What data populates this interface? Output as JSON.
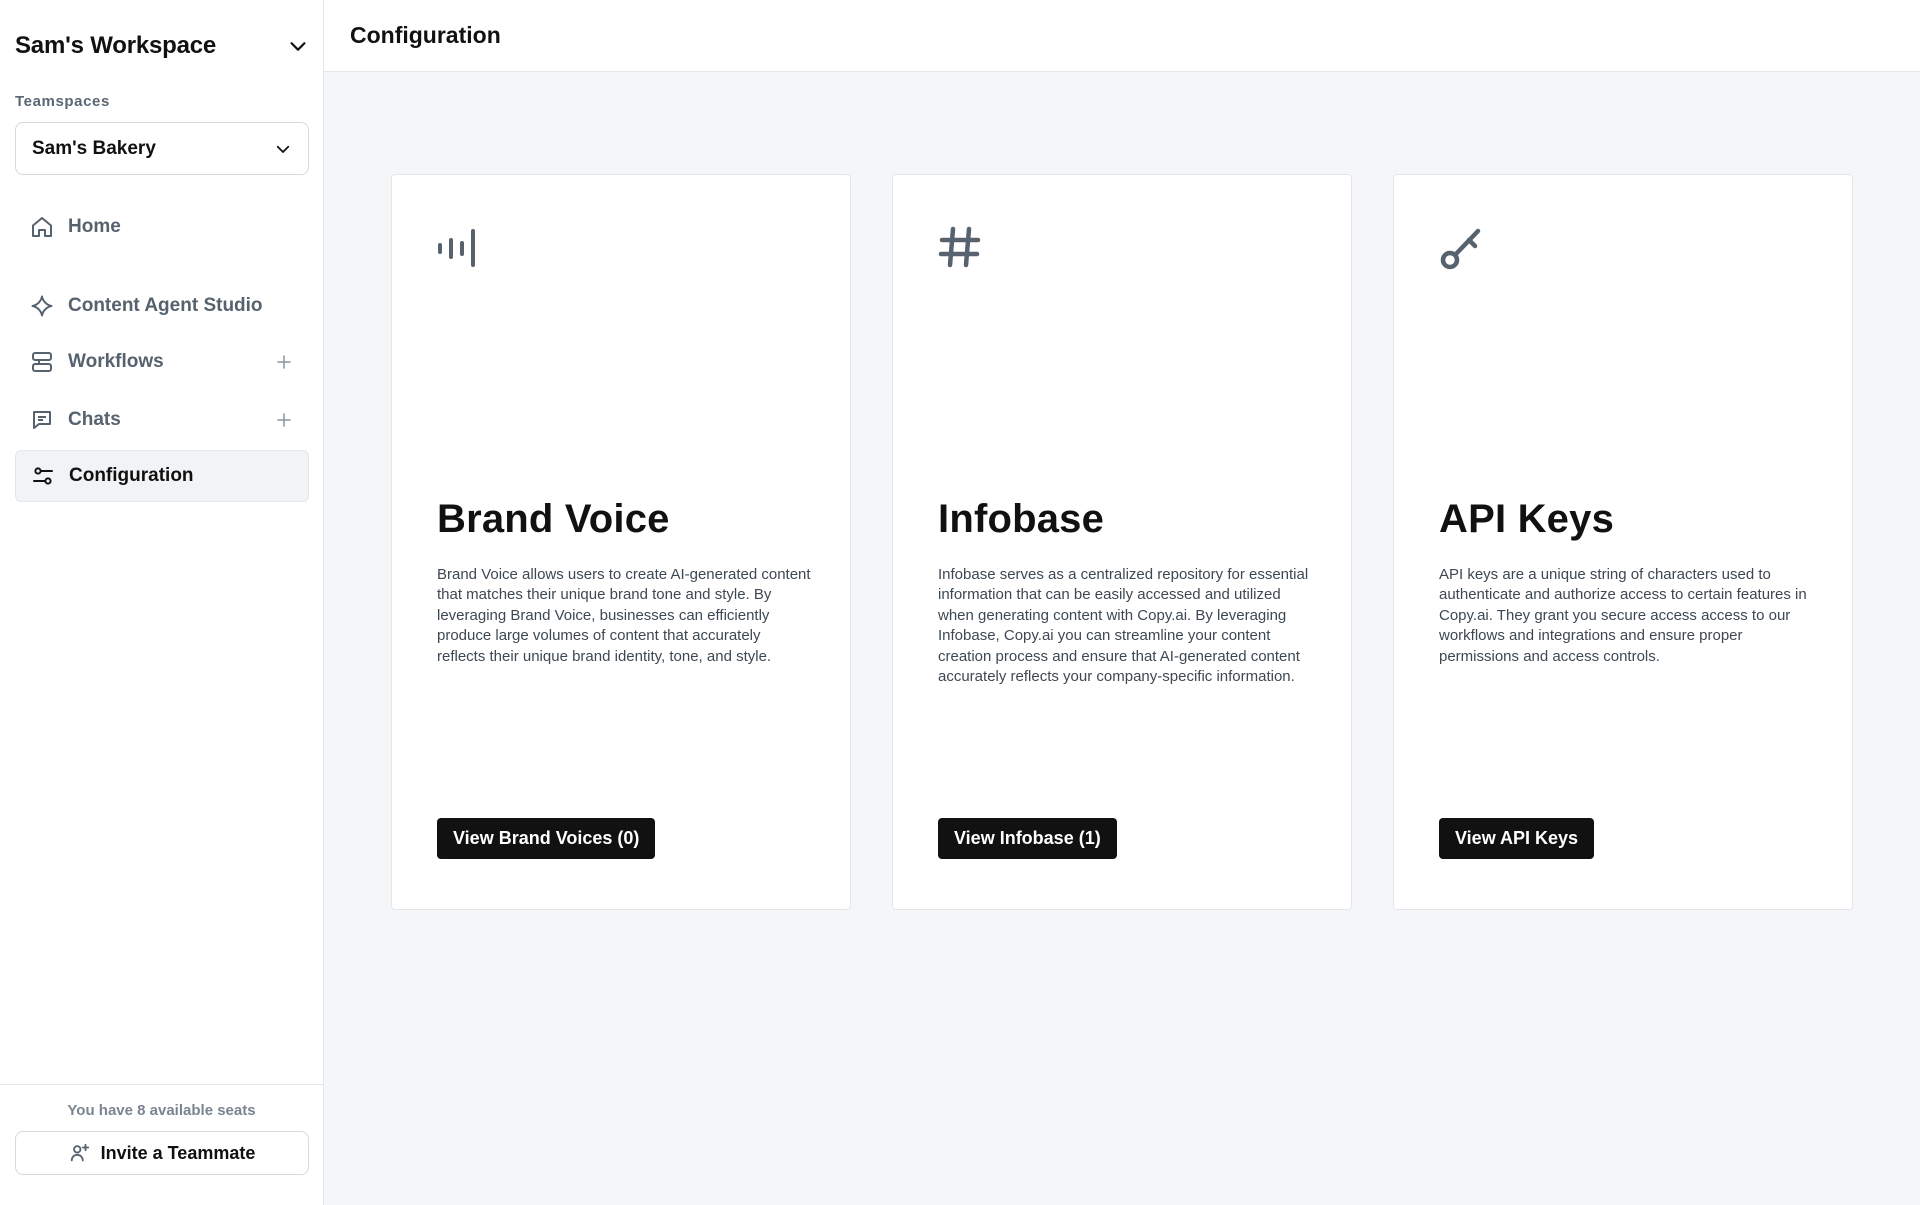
{
  "sidebar": {
    "workspace_name": "Sam's Workspace",
    "teamspaces_label": "Teamspaces",
    "teamspace_selected": "Sam's Bakery",
    "items": [
      {
        "label": "Home",
        "icon": "home-icon"
      },
      {
        "label": "Content Agent Studio",
        "icon": "sparkle-icon"
      },
      {
        "label": "Workflows",
        "icon": "workflow-icon",
        "has_add": true
      },
      {
        "label": "Chats",
        "icon": "chat-icon",
        "has_add": true
      },
      {
        "label": "Configuration",
        "icon": "sliders-icon",
        "active": true
      }
    ],
    "seats_text": "You have 8 available seats",
    "invite_label": "Invite a Teammate"
  },
  "header": {
    "title": "Configuration"
  },
  "cards": [
    {
      "icon": "audio-bars-icon",
      "title": "Brand Voice",
      "description": "Brand Voice allows users to create AI-generated content that matches their unique brand tone and style. By leveraging Brand Voice, businesses can efficiently produce large volumes of content that accurately reflects their unique brand identity, tone, and style.",
      "button_label": "View Brand Voices (0)"
    },
    {
      "icon": "hash-icon",
      "title": "Infobase",
      "description": "Infobase serves as a centralized repository for essential information that can be easily accessed and utilized when generating content with Copy.ai. By leveraging Infobase, Copy.ai you can streamline your content creation process and ensure that AI-generated content accurately reflects your company-specific information.",
      "button_label": "View Infobase (1)"
    },
    {
      "icon": "key-icon",
      "title": "API Keys",
      "description": "API keys are a unique string of characters used to authenticate and authorize access to certain features in Copy.ai. They grant you secure access access to our workflows and integrations and ensure proper permissions and access controls.",
      "button_label": "View API Keys"
    }
  ],
  "colors": {
    "icon_gray": "#56626e",
    "button_bg": "#111111",
    "page_bg": "#f4f6f8",
    "border": "#e3e7eb"
  }
}
